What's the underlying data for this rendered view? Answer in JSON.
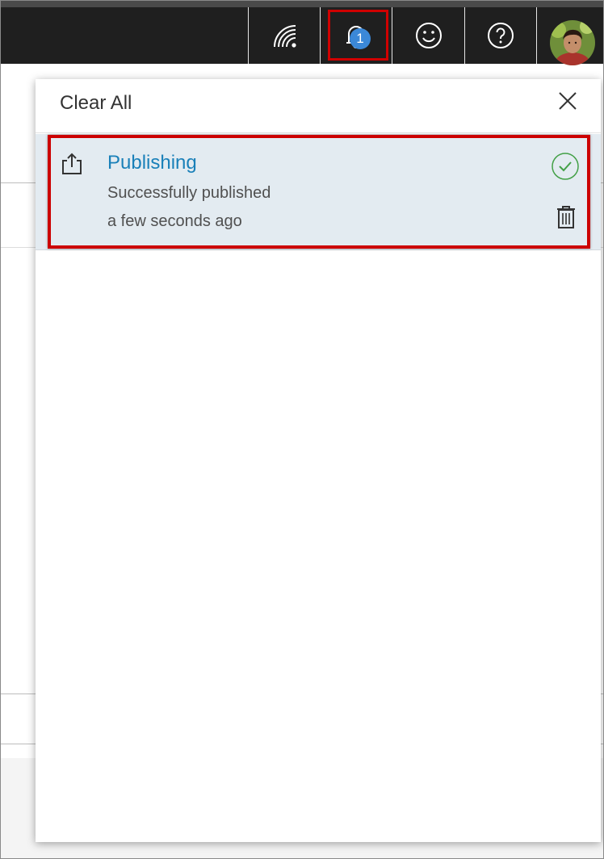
{
  "topbar": {
    "icons": [
      {
        "name": "feed-icon"
      },
      {
        "name": "bell-icon"
      },
      {
        "name": "smiley-icon"
      },
      {
        "name": "help-icon"
      }
    ],
    "notification_count": "1",
    "badge_color": "#3b88d8",
    "background_color": "#1f1f1f"
  },
  "panel": {
    "clear_all_label": "Clear All",
    "close_icon": "close-icon"
  },
  "notifications": [
    {
      "icon": "share-upload-icon",
      "title": "Publishing",
      "description": "Successfully published",
      "time": "a few seconds ago",
      "status_icon": "check-circle-icon",
      "status_color": "#43a047",
      "delete_icon": "trash-icon"
    }
  ],
  "colors": {
    "title_link": "#1a80b9",
    "highlight": "#cc0000",
    "notification_bg": "#e3ebf1"
  }
}
